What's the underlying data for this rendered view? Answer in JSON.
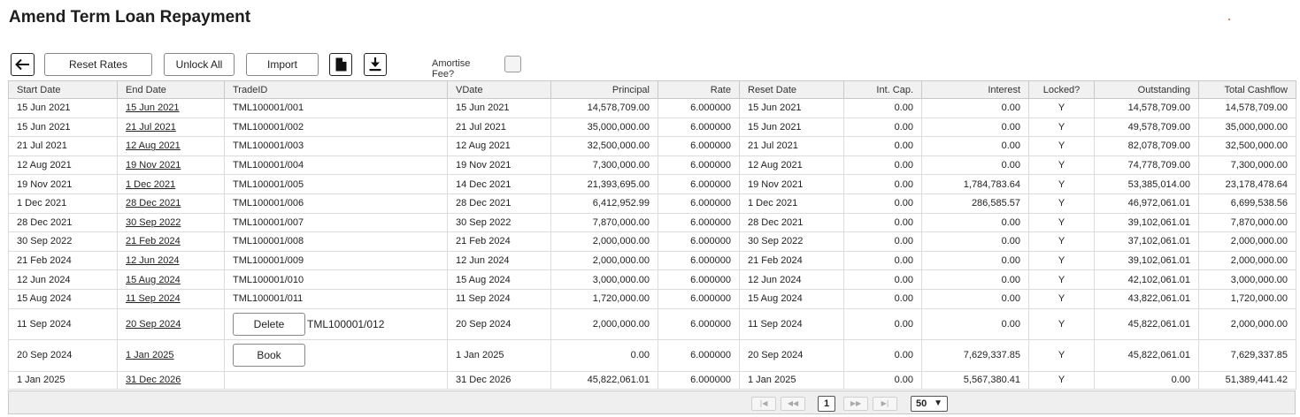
{
  "page": {
    "title": "Amend Term Loan Repayment"
  },
  "toolbar": {
    "back_icon": "arrow-left-icon",
    "reset_rates": "Reset Rates",
    "unlock_all": "Unlock All",
    "import": "Import",
    "doc_icon": "document-icon",
    "download_icon": "download-icon",
    "amortise_label": "Amortise Fee?",
    "amortise_checked": false
  },
  "grid": {
    "columns": [
      "Start Date",
      "End Date",
      "TradeID",
      "VDate",
      "Principal",
      "Rate",
      "Reset Date",
      "Int. Cap.",
      "Interest",
      "Locked?",
      "Outstanding",
      "Total Cashflow"
    ],
    "rows": [
      {
        "start": "15 Jun 2021",
        "end": "15 Jun 2021",
        "trade": "TML100001/001",
        "vdate": "15 Jun 2021",
        "principal": "14,578,709.00",
        "rate": "6.000000",
        "reset": "15 Jun 2021",
        "intcap": "0.00",
        "interest": "0.00",
        "locked": "Y",
        "outstanding": "14,578,709.00",
        "total": "14,578,709.00"
      },
      {
        "start": "15 Jun 2021",
        "end": "21 Jul 2021",
        "trade": "TML100001/002",
        "vdate": "21 Jul 2021",
        "principal": "35,000,000.00",
        "rate": "6.000000",
        "reset": "15 Jun 2021",
        "intcap": "0.00",
        "interest": "0.00",
        "locked": "Y",
        "outstanding": "49,578,709.00",
        "total": "35,000,000.00"
      },
      {
        "start": "21 Jul 2021",
        "end": "12 Aug 2021",
        "trade": "TML100001/003",
        "vdate": "12 Aug 2021",
        "principal": "32,500,000.00",
        "rate": "6.000000",
        "reset": "21 Jul 2021",
        "intcap": "0.00",
        "interest": "0.00",
        "locked": "Y",
        "outstanding": "82,078,709.00",
        "total": "32,500,000.00"
      },
      {
        "start": "12 Aug 2021",
        "end": "19 Nov 2021",
        "trade": "TML100001/004",
        "vdate": "19 Nov 2021",
        "principal": "7,300,000.00",
        "rate": "6.000000",
        "reset": "12 Aug 2021",
        "intcap": "0.00",
        "interest": "0.00",
        "locked": "Y",
        "outstanding": "74,778,709.00",
        "total": "7,300,000.00"
      },
      {
        "start": "19 Nov 2021",
        "end": "1 Dec 2021",
        "trade": "TML100001/005",
        "vdate": "14 Dec 2021",
        "principal": "21,393,695.00",
        "rate": "6.000000",
        "reset": "19 Nov 2021",
        "intcap": "0.00",
        "interest": "1,784,783.64",
        "locked": "Y",
        "outstanding": "53,385,014.00",
        "total": "23,178,478.64"
      },
      {
        "start": "1 Dec 2021",
        "end": "28 Dec 2021",
        "trade": "TML100001/006",
        "vdate": "28 Dec 2021",
        "principal": "6,412,952.99",
        "rate": "6.000000",
        "reset": "1 Dec 2021",
        "intcap": "0.00",
        "interest": "286,585.57",
        "locked": "Y",
        "outstanding": "46,972,061.01",
        "total": "6,699,538.56"
      },
      {
        "start": "28 Dec 2021",
        "end": "30 Sep 2022",
        "trade": "TML100001/007",
        "vdate": "30 Sep 2022",
        "principal": "7,870,000.00",
        "rate": "6.000000",
        "reset": "28 Dec 2021",
        "intcap": "0.00",
        "interest": "0.00",
        "locked": "Y",
        "outstanding": "39,102,061.01",
        "total": "7,870,000.00"
      },
      {
        "start": "30 Sep 2022",
        "end": "21 Feb 2024",
        "trade": "TML100001/008",
        "vdate": "21 Feb 2024",
        "principal": "2,000,000.00",
        "rate": "6.000000",
        "reset": "30 Sep 2022",
        "intcap": "0.00",
        "interest": "0.00",
        "locked": "Y",
        "outstanding": "37,102,061.01",
        "total": "2,000,000.00"
      },
      {
        "start": "21 Feb 2024",
        "end": "12 Jun 2024",
        "trade": "TML100001/009",
        "vdate": "12 Jun 2024",
        "principal": "2,000,000.00",
        "rate": "6.000000",
        "reset": "21 Feb 2024",
        "intcap": "0.00",
        "interest": "0.00",
        "locked": "Y",
        "outstanding": "39,102,061.01",
        "total": "2,000,000.00"
      },
      {
        "start": "12 Jun 2024",
        "end": "15 Aug 2024",
        "trade": "TML100001/010",
        "vdate": "15 Aug 2024",
        "principal": "3,000,000.00",
        "rate": "6.000000",
        "reset": "12 Jun 2024",
        "intcap": "0.00",
        "interest": "0.00",
        "locked": "Y",
        "outstanding": "42,102,061.01",
        "total": "3,000,000.00"
      },
      {
        "start": "15 Aug 2024",
        "end": "11 Sep 2024",
        "trade": "TML100001/011",
        "vdate": "11 Sep 2024",
        "principal": "1,720,000.00",
        "rate": "6.000000",
        "reset": "15 Aug 2024",
        "intcap": "0.00",
        "interest": "0.00",
        "locked": "Y",
        "outstanding": "43,822,061.01",
        "total": "1,720,000.00"
      },
      {
        "start": "11 Sep 2024",
        "end": "20 Sep 2024",
        "trade": "TML100001/012",
        "button": "Delete",
        "vdate": "20 Sep 2024",
        "principal": "2,000,000.00",
        "rate": "6.000000",
        "reset": "11 Sep 2024",
        "intcap": "0.00",
        "interest": "0.00",
        "locked": "Y",
        "outstanding": "45,822,061.01",
        "total": "2,000,000.00"
      },
      {
        "start": "20 Sep 2024",
        "end": "1 Jan 2025",
        "trade": "",
        "button": "Book",
        "vdate": "1 Jan 2025",
        "principal": "0.00",
        "rate": "6.000000",
        "reset": "20 Sep 2024",
        "intcap": "0.00",
        "interest": "7,629,337.85",
        "locked": "Y",
        "outstanding": "45,822,061.01",
        "total": "7,629,337.85"
      },
      {
        "start": "1 Jan 2025",
        "end": "31 Dec 2026",
        "trade": "",
        "vdate": "31 Dec 2026",
        "principal": "45,822,061.01",
        "rate": "6.000000",
        "reset": "1 Jan 2025",
        "intcap": "0.00",
        "interest": "5,567,380.41",
        "locked": "Y",
        "outstanding": "0.00",
        "total": "51,389,441.42"
      }
    ]
  },
  "pager": {
    "first_icon": "first-page-icon",
    "prev_icon": "prev-page-icon",
    "current_page": "1",
    "next_icon": "next-page-icon",
    "last_icon": "last-page-icon",
    "page_size": "50"
  }
}
